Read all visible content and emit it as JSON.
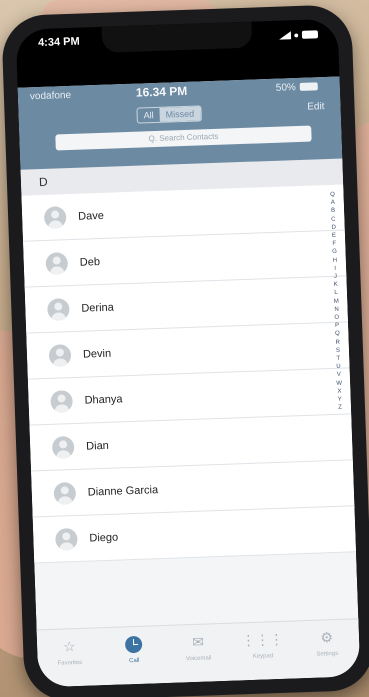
{
  "device": {
    "status_time": "4:34 PM"
  },
  "app": {
    "status": {
      "carrier": "vodafone",
      "time": "16.34 PM",
      "battery": "50%"
    },
    "segments": [
      "All",
      "Missed"
    ],
    "edit_label": "Edit",
    "search_placeholder": "Q. Search Contacts",
    "section_header": "D",
    "contacts": [
      "Dave",
      "Deb",
      "Derina",
      "Devin",
      "Dhanya",
      "Dian",
      "Dianne Garcia",
      "Diego"
    ],
    "alphabet": [
      "Q",
      "A",
      "B",
      "C",
      "D",
      "E",
      "F",
      "G",
      "H",
      "I",
      "J",
      "K",
      "L",
      "M",
      "N",
      "O",
      "P",
      "Q",
      "R",
      "S",
      "T",
      "U",
      "V",
      "W",
      "X",
      "Y",
      "Z"
    ],
    "tabs": [
      {
        "label": "Favorites",
        "icon": "star-icon"
      },
      {
        "label": "Call",
        "icon": "clock-icon"
      },
      {
        "label": "Voicemail",
        "icon": "envelope-icon"
      },
      {
        "label": "Keypad",
        "icon": "keypad-icon"
      },
      {
        "label": "Settings",
        "icon": "gear-icon"
      }
    ],
    "accent_color": "#3b74a3",
    "header_color": "#6d8aa3"
  }
}
